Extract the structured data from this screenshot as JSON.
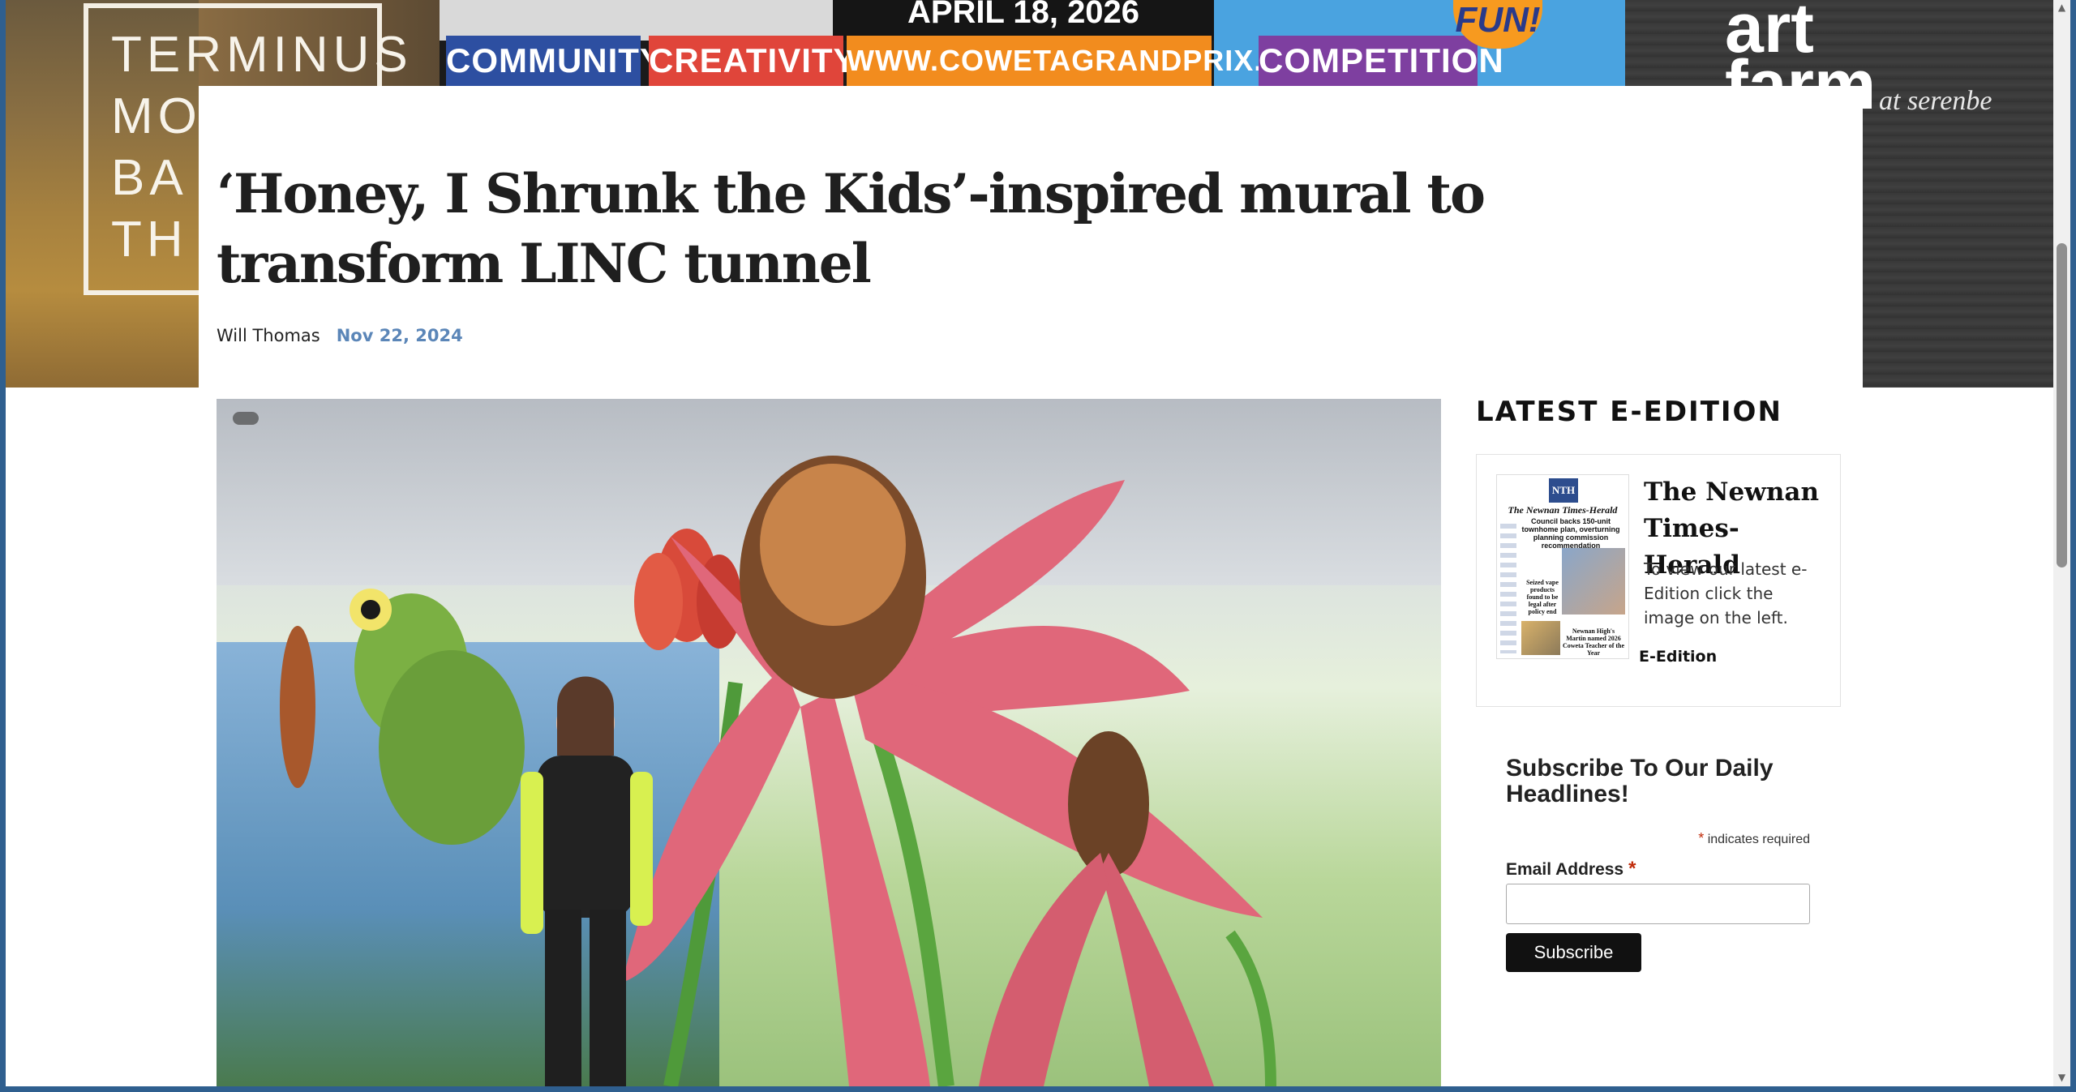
{
  "banner": {
    "left_ad_text": "TERMINUS\nMO\nBA\nTH",
    "leaderboard": {
      "date": "APRIL 18, 2026",
      "segments": [
        "COMMUNITY",
        "CREATIVITY",
        "WWW.COWETAGRANDPRIX.COM",
        "COMPETITION"
      ],
      "badge": "FUN!",
      "segment_colors": [
        "#2d4fa1",
        "#e0453a",
        "#f28c1e",
        "#7e3fa0"
      ]
    },
    "right_ad_title": "art\nfarm",
    "right_ad_subtitle": "at serenbe"
  },
  "article": {
    "title": "‘Honey, I Shrunk the Kids’-inspired mural to transform LINC tunnel",
    "author": "Will Thomas",
    "date": "Nov 22, 2024"
  },
  "sidebar": {
    "heading": "LATEST E-EDITION",
    "eedition": {
      "thumb_logo": "NTH",
      "thumb_masthead": "The Newnan Times-Herald",
      "thumb_headline": "Council backs 150-unit townhome plan, overturning planning commission recommendation",
      "thumb_caption_left": "Seized vape products found to be legal after policy end",
      "thumb_caption_right": "Newnan High's Martin named 2026 Coweta Teacher of the Year",
      "name": "The Newnan Times-Herald",
      "description": "To view our latest e-Edition click the image on the left.",
      "link_label": "E-Edition"
    },
    "subscribe": {
      "title": "Subscribe To Our Daily Headlines!",
      "required_note": "indicates required",
      "required_mark": "*",
      "email_label": "Email Address",
      "email_value": "",
      "email_placeholder": "",
      "button_label": "Subscribe"
    }
  },
  "colors": {
    "accent_date": "#5b86b8",
    "button": "#111111",
    "required": "#c02b0a"
  }
}
